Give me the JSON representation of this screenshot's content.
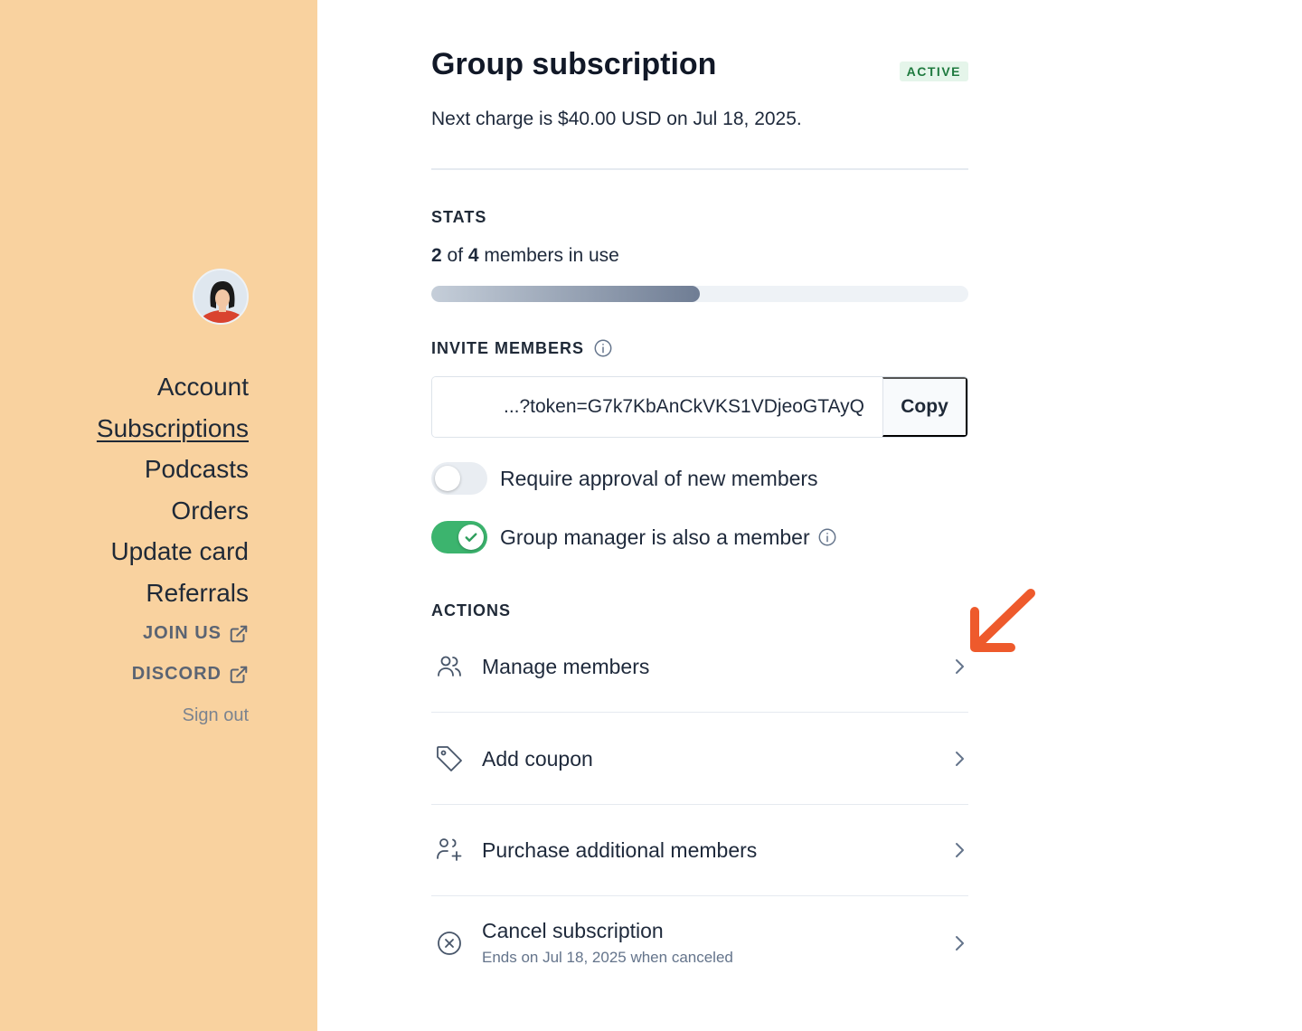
{
  "sidebar": {
    "nav": [
      {
        "label": "Account",
        "active": false
      },
      {
        "label": "Subscriptions",
        "active": true
      },
      {
        "label": "Podcasts",
        "active": false
      },
      {
        "label": "Orders",
        "active": false
      },
      {
        "label": "Update card",
        "active": false
      },
      {
        "label": "Referrals",
        "active": false
      }
    ],
    "external_links": [
      {
        "label": "JOIN US",
        "icon": "external-link-icon"
      },
      {
        "label": "DISCORD",
        "icon": "external-link-icon"
      }
    ],
    "sign_out": "Sign out",
    "background_color": "#f9d29f"
  },
  "subscription": {
    "title": "Group subscription",
    "status": "ACTIVE",
    "next_charge": "Next charge is $40.00 USD on Jul 18, 2025."
  },
  "stats": {
    "label": "STATS",
    "used": "2",
    "of": "of",
    "total": "4",
    "suffix": "members in use",
    "progress_fraction": 0.5
  },
  "invite": {
    "label": "INVITE MEMBERS",
    "link_value": "...?token=G7k7KbAnCkVKS1VDjeoGTAyQ",
    "copy_label": "Copy"
  },
  "toggles": [
    {
      "label": "Require approval of new members",
      "on": false
    },
    {
      "label": "Group manager is also a member",
      "on": true
    }
  ],
  "actions": {
    "label": "ACTIONS",
    "items": [
      {
        "label": "Manage members",
        "icon": "users-icon",
        "sub": ""
      },
      {
        "label": "Add coupon",
        "icon": "tag-icon",
        "sub": ""
      },
      {
        "label": "Purchase additional members",
        "icon": "user-plus-icon",
        "sub": ""
      },
      {
        "label": "Cancel subscription",
        "icon": "x-circle-icon",
        "sub": "Ends on Jul 18, 2025 when canceled"
      }
    ]
  },
  "colors": {
    "accent_green": "#3cb46e",
    "annotation_arrow": "#ee5a2c"
  }
}
